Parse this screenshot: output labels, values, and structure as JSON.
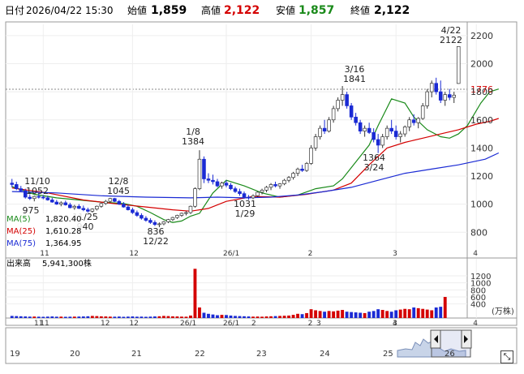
{
  "header": {
    "date_label": "日付",
    "date": "2026/04/22 15:30",
    "open_label": "始値",
    "open": "1,859",
    "high_label": "高値",
    "high": "2,122",
    "low_label": "安値",
    "low": "1,857",
    "close_label": "終値",
    "close": "2,122"
  },
  "legend": [
    {
      "label": "MA(5)",
      "value": "1,820.40",
      "color": "#1a8a1a"
    },
    {
      "label": "MA(25)",
      "value": "1,610.28",
      "color": "#d40000"
    },
    {
      "label": "MA(75)",
      "value": "1,364.95",
      "color": "#1a2ad4"
    }
  ],
  "volume_header": {
    "label": "出来高",
    "value": "5,941,300株"
  },
  "current_price_label": "1776",
  "navigator": {
    "date_labels": [
      "19",
      "20",
      "21",
      "22",
      "23",
      "24",
      "25",
      "26"
    ],
    "month_labels": [
      "11",
      "12",
      "26/1",
      "2",
      "3",
      "4"
    ]
  },
  "colors": {
    "up": "#ffffff",
    "down": "#1a2ad4",
    "vol_up": "#d40000",
    "vol_down": "#1a2ad4"
  },
  "chart_data": {
    "type": "candlestick",
    "price_axis": {
      "min": 640,
      "max": 2280,
      "ticks": [
        800,
        1000,
        1200,
        1400,
        1600,
        1800,
        2000,
        2200
      ]
    },
    "volume_axis": {
      "min": 0,
      "max": 1500,
      "ticks": [
        400,
        600,
        800,
        1000,
        1200
      ],
      "unit_label": "(万株)"
    },
    "x_month_labels": [
      "11",
      "12",
      "26/1",
      "2",
      "3",
      "4"
    ],
    "annotations": [
      {
        "date": "11/10",
        "value": "1052"
      },
      {
        "date": "",
        "value": "975"
      },
      {
        "date": "11/25",
        "value": "940"
      },
      {
        "date": "12/8",
        "value": "1045"
      },
      {
        "date": "12/22",
        "value": "836"
      },
      {
        "date": "1/8",
        "value": "1384"
      },
      {
        "date": "1/29",
        "value": "1031"
      },
      {
        "date": "3/16",
        "value": "1841"
      },
      {
        "date": "3/24",
        "value": "1364"
      },
      {
        "date": "4/22",
        "value": "2122"
      }
    ],
    "series_ma": [
      {
        "name": "MA(5)",
        "color": "#1a8a1a",
        "points": [
          [
            0,
            1125
          ],
          [
            5,
            1070
          ],
          [
            10,
            1045
          ],
          [
            15,
            1030
          ],
          [
            20,
            1015
          ],
          [
            25,
            1005
          ],
          [
            28,
            985
          ],
          [
            31,
            940
          ],
          [
            34,
            890
          ],
          [
            36,
            870
          ],
          [
            38,
            880
          ],
          [
            40,
            915
          ],
          [
            42,
            935
          ],
          [
            45,
            1080
          ],
          [
            48,
            1170
          ],
          [
            52,
            1130
          ],
          [
            56,
            1080
          ],
          [
            60,
            1050
          ],
          [
            64,
            1065
          ],
          [
            68,
            1110
          ],
          [
            72,
            1130
          ],
          [
            74,
            1180
          ],
          [
            76,
            1260
          ],
          [
            78,
            1340
          ],
          [
            80,
            1420
          ],
          [
            82,
            1560
          ],
          [
            85,
            1750
          ],
          [
            88,
            1720
          ],
          [
            90,
            1620
          ],
          [
            93,
            1530
          ],
          [
            96,
            1480
          ],
          [
            98,
            1470
          ],
          [
            100,
            1500
          ],
          [
            102,
            1560
          ],
          [
            105,
            1720
          ],
          [
            107,
            1800
          ],
          [
            109,
            1820
          ]
        ]
      },
      {
        "name": "MA(25)",
        "color": "#d40000",
        "points": [
          [
            0,
            1115
          ],
          [
            8,
            1080
          ],
          [
            16,
            1030
          ],
          [
            24,
            1000
          ],
          [
            30,
            980
          ],
          [
            36,
            960
          ],
          [
            40,
            950
          ],
          [
            44,
            970
          ],
          [
            48,
            1020
          ],
          [
            54,
            1055
          ],
          [
            60,
            1050
          ],
          [
            66,
            1070
          ],
          [
            72,
            1100
          ],
          [
            76,
            1150
          ],
          [
            80,
            1280
          ],
          [
            84,
            1400
          ],
          [
            88,
            1440
          ],
          [
            92,
            1470
          ],
          [
            96,
            1500
          ],
          [
            100,
            1530
          ],
          [
            104,
            1570
          ],
          [
            107,
            1590
          ],
          [
            109,
            1610
          ]
        ]
      },
      {
        "name": "MA(75)",
        "color": "#1a2ad4",
        "points": [
          [
            0,
            1090
          ],
          [
            10,
            1080
          ],
          [
            20,
            1060
          ],
          [
            30,
            1050
          ],
          [
            40,
            1045
          ],
          [
            46,
            1050
          ],
          [
            52,
            1045
          ],
          [
            58,
            1050
          ],
          [
            64,
            1065
          ],
          [
            70,
            1090
          ],
          [
            76,
            1120
          ],
          [
            82,
            1170
          ],
          [
            88,
            1220
          ],
          [
            94,
            1250
          ],
          [
            100,
            1280
          ],
          [
            106,
            1320
          ],
          [
            109,
            1365
          ]
        ]
      }
    ],
    "candles": [
      [
        1150,
        1180,
        1120,
        1140
      ],
      [
        1140,
        1160,
        1100,
        1110
      ],
      [
        1110,
        1130,
        1085,
        1095
      ],
      [
        1095,
        1110,
        1040,
        1050
      ],
      [
        1050,
        1070,
        1030,
        1040
      ],
      [
        1040,
        1060,
        1020,
        1055
      ],
      [
        1055,
        1075,
        1040,
        1050
      ],
      [
        1050,
        1065,
        1035,
        1045
      ],
      [
        1045,
        1060,
        1025,
        1030
      ],
      [
        1030,
        1045,
        1010,
        1015
      ],
      [
        1015,
        1030,
        995,
        1000
      ],
      [
        1000,
        1020,
        985,
        1010
      ],
      [
        1010,
        1025,
        990,
        995
      ],
      [
        995,
        1010,
        970,
        975
      ],
      [
        975,
        995,
        960,
        985
      ],
      [
        985,
        1000,
        965,
        970
      ],
      [
        970,
        990,
        950,
        960
      ],
      [
        960,
        975,
        940,
        950
      ],
      [
        950,
        970,
        940,
        965
      ],
      [
        965,
        990,
        955,
        985
      ],
      [
        985,
        1010,
        975,
        1005
      ],
      [
        1005,
        1030,
        995,
        1020
      ],
      [
        1020,
        1045,
        1010,
        1040
      ],
      [
        1040,
        1045,
        1015,
        1020
      ],
      [
        1020,
        1030,
        995,
        1000
      ],
      [
        1000,
        1015,
        975,
        980
      ],
      [
        980,
        995,
        955,
        960
      ],
      [
        960,
        975,
        930,
        940
      ],
      [
        940,
        955,
        910,
        920
      ],
      [
        920,
        935,
        890,
        900
      ],
      [
        900,
        915,
        875,
        885
      ],
      [
        885,
        900,
        860,
        870
      ],
      [
        870,
        885,
        845,
        855
      ],
      [
        855,
        870,
        836,
        860
      ],
      [
        860,
        880,
        850,
        875
      ],
      [
        875,
        895,
        865,
        890
      ],
      [
        890,
        910,
        880,
        905
      ],
      [
        905,
        925,
        895,
        920
      ],
      [
        920,
        940,
        910,
        935
      ],
      [
        935,
        950,
        920,
        940
      ],
      [
        940,
        990,
        930,
        985
      ],
      [
        985,
        1120,
        975,
        1110
      ],
      [
        1110,
        1384,
        1100,
        1320
      ],
      [
        1320,
        1340,
        1150,
        1180
      ],
      [
        1180,
        1220,
        1150,
        1170
      ],
      [
        1170,
        1210,
        1140,
        1160
      ],
      [
        1160,
        1180,
        1120,
        1130
      ],
      [
        1130,
        1160,
        1110,
        1150
      ],
      [
        1150,
        1170,
        1120,
        1135
      ],
      [
        1135,
        1150,
        1100,
        1110
      ],
      [
        1110,
        1125,
        1080,
        1090
      ],
      [
        1090,
        1110,
        1060,
        1075
      ],
      [
        1075,
        1090,
        1040,
        1050
      ],
      [
        1050,
        1065,
        1031,
        1045
      ],
      [
        1045,
        1070,
        1035,
        1060
      ],
      [
        1060,
        1090,
        1050,
        1085
      ],
      [
        1085,
        1110,
        1070,
        1100
      ],
      [
        1100,
        1130,
        1085,
        1120
      ],
      [
        1120,
        1150,
        1100,
        1140
      ],
      [
        1140,
        1160,
        1120,
        1130
      ],
      [
        1130,
        1150,
        1110,
        1145
      ],
      [
        1145,
        1180,
        1135,
        1170
      ],
      [
        1170,
        1200,
        1155,
        1190
      ],
      [
        1190,
        1230,
        1175,
        1220
      ],
      [
        1220,
        1260,
        1200,
        1250
      ],
      [
        1250,
        1280,
        1230,
        1240
      ],
      [
        1240,
        1300,
        1230,
        1290
      ],
      [
        1290,
        1420,
        1280,
        1400
      ],
      [
        1400,
        1500,
        1380,
        1480
      ],
      [
        1480,
        1560,
        1460,
        1540
      ],
      [
        1540,
        1600,
        1500,
        1520
      ],
      [
        1520,
        1620,
        1510,
        1600
      ],
      [
        1600,
        1700,
        1580,
        1680
      ],
      [
        1680,
        1760,
        1660,
        1740
      ],
      [
        1740,
        1841,
        1700,
        1780
      ],
      [
        1780,
        1800,
        1680,
        1700
      ],
      [
        1700,
        1720,
        1600,
        1620
      ],
      [
        1620,
        1650,
        1560,
        1580
      ],
      [
        1580,
        1600,
        1500,
        1520
      ],
      [
        1520,
        1560,
        1480,
        1540
      ],
      [
        1540,
        1580,
        1500,
        1510
      ],
      [
        1510,
        1540,
        1440,
        1460
      ],
      [
        1460,
        1500,
        1364,
        1420
      ],
      [
        1420,
        1500,
        1400,
        1480
      ],
      [
        1480,
        1560,
        1460,
        1540
      ],
      [
        1540,
        1600,
        1500,
        1520
      ],
      [
        1520,
        1560,
        1460,
        1480
      ],
      [
        1480,
        1520,
        1440,
        1500
      ],
      [
        1500,
        1560,
        1480,
        1550
      ],
      [
        1550,
        1620,
        1520,
        1600
      ],
      [
        1600,
        1640,
        1560,
        1580
      ],
      [
        1580,
        1620,
        1540,
        1610
      ],
      [
        1610,
        1720,
        1600,
        1700
      ],
      [
        1700,
        1820,
        1680,
        1800
      ],
      [
        1800,
        1880,
        1760,
        1860
      ],
      [
        1860,
        1900,
        1780,
        1800
      ],
      [
        1800,
        1880,
        1720,
        1740
      ],
      [
        1740,
        1800,
        1700,
        1780
      ],
      [
        1780,
        1820,
        1740,
        1760
      ],
      [
        1760,
        1800,
        1720,
        1776
      ],
      [
        1859,
        2122,
        1857,
        2122
      ]
    ],
    "volume": [
      60,
      55,
      50,
      45,
      40,
      42,
      38,
      35,
      40,
      45,
      38,
      40,
      35,
      38,
      40,
      42,
      45,
      50,
      60,
      55,
      48,
      45,
      40,
      38,
      42,
      35,
      40,
      45,
      38,
      40,
      35,
      40,
      45,
      50,
      60,
      55,
      48,
      45,
      40,
      38,
      70,
      1400,
      300,
      150,
      120,
      100,
      80,
      90,
      85,
      70,
      60,
      55,
      50,
      45,
      40,
      42,
      38,
      45,
      50,
      55,
      60,
      65,
      70,
      90,
      120,
      110,
      140,
      250,
      220,
      200,
      180,
      200,
      190,
      210,
      230,
      180,
      170,
      160,
      150,
      140,
      180,
      200,
      250,
      230,
      200,
      180,
      220,
      240,
      260,
      250,
      300,
      280,
      260,
      240,
      220,
      300,
      320,
      600
    ]
  }
}
